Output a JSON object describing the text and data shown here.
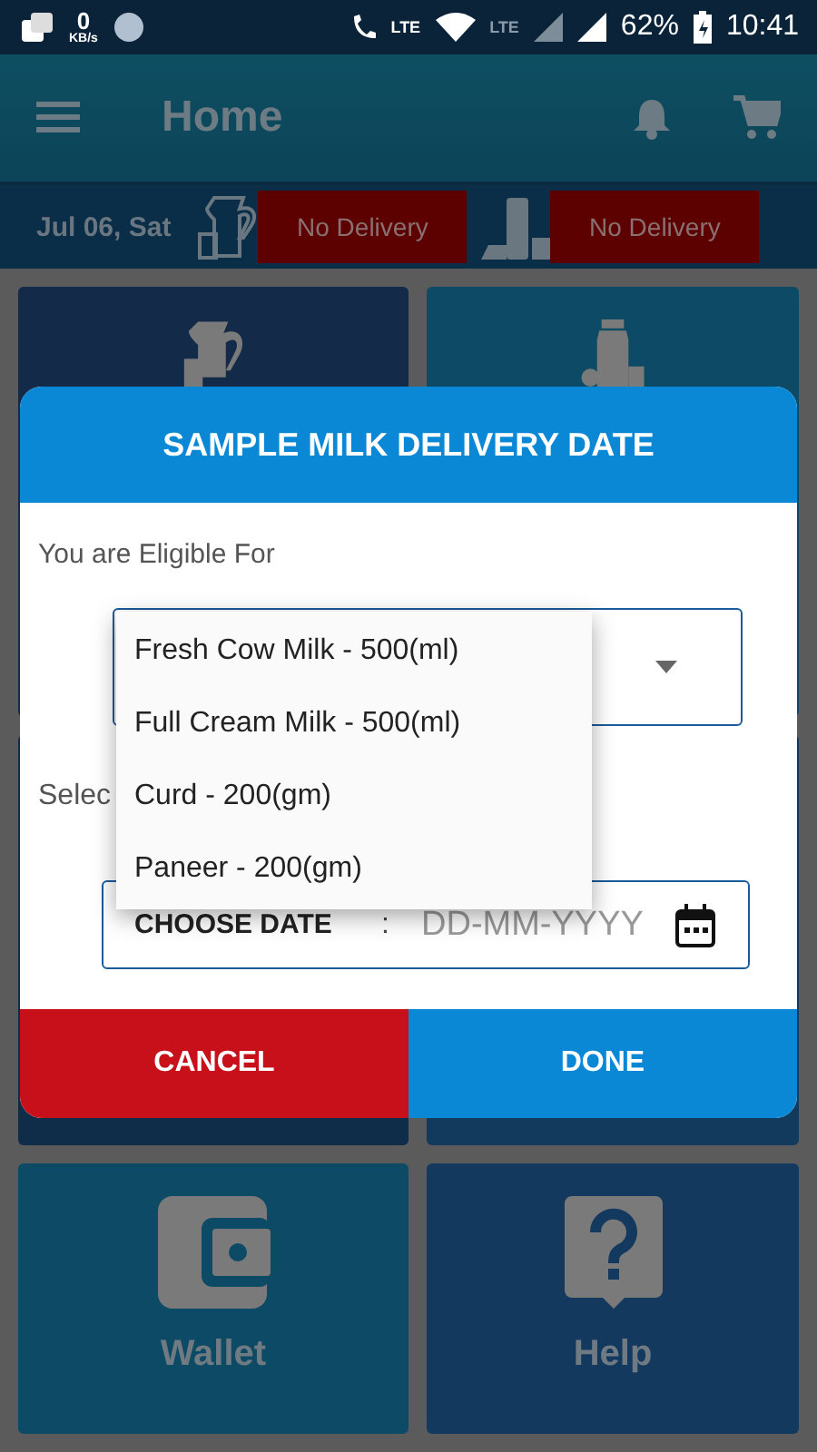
{
  "status_bar": {
    "speed_value": "0",
    "speed_unit": "KB/s",
    "call_label": "LTE",
    "network_label": "LTE",
    "battery": "62%",
    "time": "10:41"
  },
  "app_bar": {
    "title": "Home"
  },
  "delivery_strip": {
    "date": "Jul 06, Sat",
    "deliveries": [
      {
        "kind": "milk",
        "status": "No Delivery"
      },
      {
        "kind": "products",
        "status": "No Delivery"
      }
    ]
  },
  "tiles": [
    {
      "kind": "milk"
    },
    {
      "kind": "products"
    },
    {
      "kind": "blank"
    },
    {
      "kind": "blank"
    },
    {
      "kind": "wallet",
      "label": "Wallet"
    },
    {
      "kind": "help",
      "label": "Help"
    }
  ],
  "dialog": {
    "title": "SAMPLE MILK DELIVERY DATE",
    "eligible_label": "You are Eligible For",
    "dropdown": {
      "expanded": true,
      "options": [
        {
          "label": "Fresh Cow Milk - 500(ml)"
        },
        {
          "label": "Full Cream Milk - 500(ml)"
        },
        {
          "label": "Curd - 200(gm)"
        },
        {
          "label": "Paneer - 200(gm)"
        }
      ]
    },
    "select_label": "Selec",
    "date_label": "CHOOSE DATE",
    "date_separator": ":",
    "date_placeholder": "DD-MM-YYYY",
    "buttons": [
      {
        "kind": "cancel",
        "label": "CANCEL"
      },
      {
        "kind": "done",
        "label": "DONE"
      }
    ]
  }
}
